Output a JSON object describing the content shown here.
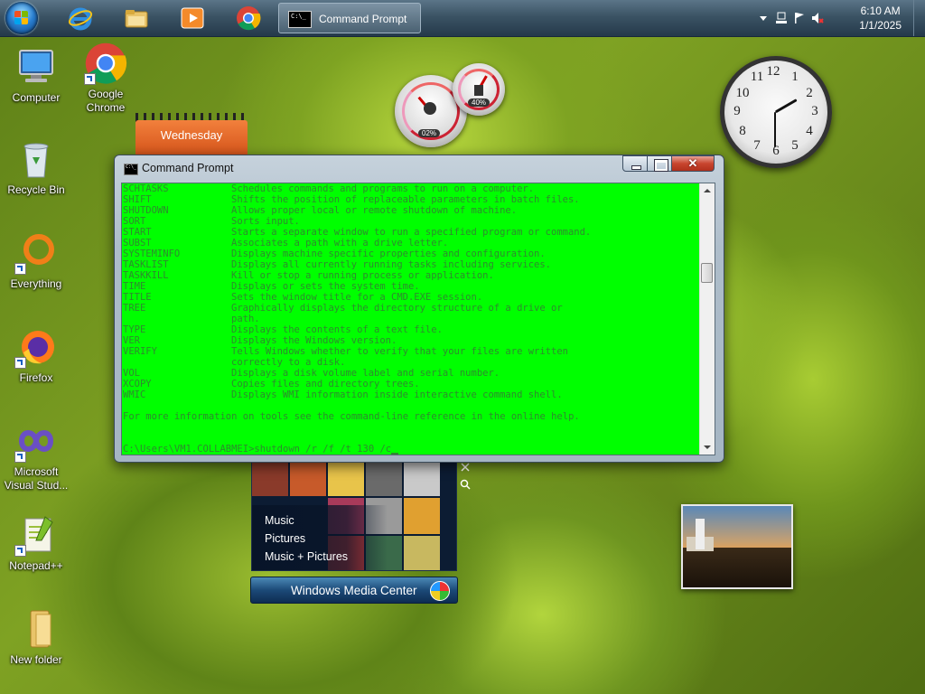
{
  "taskbar": {
    "cmd_label": "Command Prompt",
    "cmd_mini": "C:\\_",
    "clock_time": "6:10 AM",
    "clock_date": "1/1/2025"
  },
  "desktop_icons": [
    {
      "label": "Computer"
    },
    {
      "label": "Google Chrome"
    },
    {
      "label": "Recycle Bin"
    },
    {
      "label": "Everything"
    },
    {
      "label": "Firefox"
    },
    {
      "label": "Microsoft Visual Stud..."
    },
    {
      "label": "Notepad++"
    },
    {
      "label": "New folder"
    }
  ],
  "gadgets": {
    "calendar_day": "Wednesday",
    "cpu_meter": "02%",
    "memory_meter": "40%",
    "clock_numbers": [
      "12",
      "1",
      "2",
      "3",
      "4",
      "5",
      "6",
      "7",
      "8",
      "9",
      "10",
      "11"
    ]
  },
  "media_center": {
    "items": [
      "Music",
      "Pictures",
      "Music + Pictures"
    ],
    "title": "Windows Media Center"
  },
  "cmd_window": {
    "title": "Command Prompt",
    "close_glyph": "✕",
    "lines": [
      {
        "cmd": "SCHTASKS",
        "desc": "Schedules commands and programs to run on a computer."
      },
      {
        "cmd": "SHIFT",
        "desc": "Shifts the position of replaceable parameters in batch files."
      },
      {
        "cmd": "SHUTDOWN",
        "desc": "Allows proper local or remote shutdown of machine."
      },
      {
        "cmd": "SORT",
        "desc": "Sorts input."
      },
      {
        "cmd": "START",
        "desc": "Starts a separate window to run a specified program or command."
      },
      {
        "cmd": "SUBST",
        "desc": "Associates a path with a drive letter."
      },
      {
        "cmd": "SYSTEMINFO",
        "desc": "Displays machine specific properties and configuration."
      },
      {
        "cmd": "TASKLIST",
        "desc": "Displays all currently running tasks including services."
      },
      {
        "cmd": "TASKKILL",
        "desc": "Kill or stop a running process or application."
      },
      {
        "cmd": "TIME",
        "desc": "Displays or sets the system time."
      },
      {
        "cmd": "TITLE",
        "desc": "Sets the window title for a CMD.EXE session."
      },
      {
        "cmd": "TREE",
        "desc": "Graphically displays the directory structure of a drive or"
      },
      {
        "cmd": "",
        "desc": "path."
      },
      {
        "cmd": "TYPE",
        "desc": "Displays the contents of a text file."
      },
      {
        "cmd": "VER",
        "desc": "Displays the Windows version."
      },
      {
        "cmd": "VERIFY",
        "desc": "Tells Windows whether to verify that your files are written"
      },
      {
        "cmd": "",
        "desc": "correctly to a disk."
      },
      {
        "cmd": "VOL",
        "desc": "Displays a disk volume label and serial number."
      },
      {
        "cmd": "XCOPY",
        "desc": "Copies files and directory trees."
      },
      {
        "cmd": "WMIC",
        "desc": "Displays WMI information inside interactive command shell."
      }
    ],
    "footer": "For more information on tools see the command-line reference in the online help.",
    "prompt": "C:\\Users\\VM1.COLLABMEI>shutdown /r /f /t 130 /c"
  }
}
